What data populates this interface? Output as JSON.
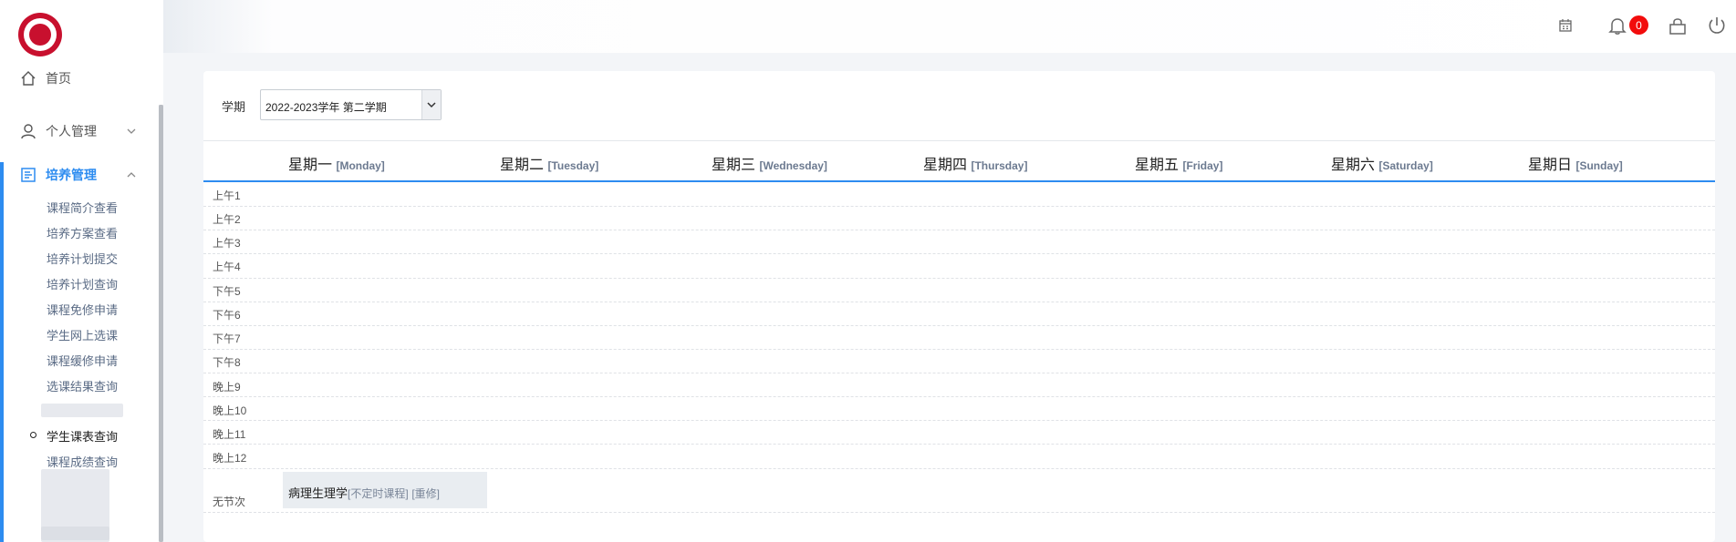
{
  "header": {
    "notification_count": "0",
    "icons": [
      "calendar-icon",
      "bell-icon",
      "lock-icon",
      "power-icon"
    ]
  },
  "sidebar": {
    "home": "首页",
    "personal": "个人管理",
    "training": "培养管理",
    "sub_items": [
      "课程简介查看",
      "培养方案查看",
      "培养计划提交",
      "培养计划查询",
      "课程免修申请",
      "学生网上选课",
      "课程缓修申请",
      "选课结果查询",
      "学生课表查询",
      "课程成绩查询"
    ]
  },
  "filter": {
    "term_label": "学期",
    "term_value": "2022-2023学年 第二学期"
  },
  "days": [
    {
      "cn": "星期一",
      "en": "[Monday]"
    },
    {
      "cn": "星期二",
      "en": "[Tuesday]"
    },
    {
      "cn": "星期三",
      "en": "[Wednesday]"
    },
    {
      "cn": "星期四",
      "en": "[Thursday]"
    },
    {
      "cn": "星期五",
      "en": "[Friday]"
    },
    {
      "cn": "星期六",
      "en": "[Saturday]"
    },
    {
      "cn": "星期日",
      "en": "[Sunday]"
    }
  ],
  "periods": [
    "上午1",
    "上午2",
    "上午3",
    "上午4",
    "下午5",
    "下午6",
    "下午7",
    "下午8",
    "晚上9",
    "晚上10",
    "晚上11",
    "晚上12"
  ],
  "no_period_label": "无节次",
  "unscheduled_course": {
    "name": "病理生理学",
    "type": "[不定时课程]",
    "status": "[重修]"
  },
  "colors": {
    "accent": "#2d8cf0",
    "badge": "#f20c0c",
    "logo": "#c8102e"
  }
}
